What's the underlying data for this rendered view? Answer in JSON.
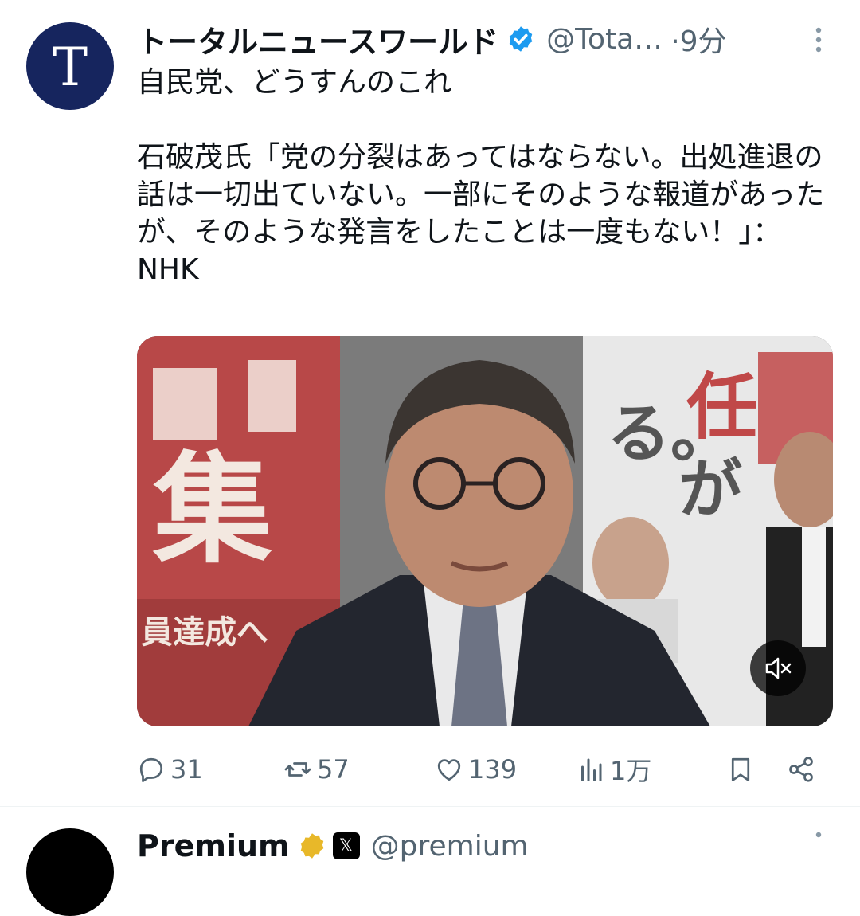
{
  "tweet": {
    "author": {
      "avatar_letter": "T",
      "name": "トータルニュースワールド",
      "handle": "@Tota…",
      "time": "·9分"
    },
    "text": "自民党、どうすんのこれ\n\n石破茂氏「党の分裂はあってはならない。出処進退の話は一切出ていない。一部にそのような報道があったが、そのような発言をしたことは一度もない！」：NHK",
    "media": {
      "sign_chars_left": [
        "集",
        "員達成へ"
      ],
      "sign_chars_right": [
        "る。",
        "任",
        "が"
      ]
    },
    "actions": {
      "replies": "31",
      "reposts": "57",
      "likes": "139",
      "views": "1万"
    }
  },
  "next_tweet": {
    "name": "Premium",
    "x_glyph": "𝕏",
    "handle": "@premium"
  },
  "colors": {
    "verified": "#1d9bf0",
    "muted_text": "#536471",
    "avatar_bg": "#16255e"
  }
}
